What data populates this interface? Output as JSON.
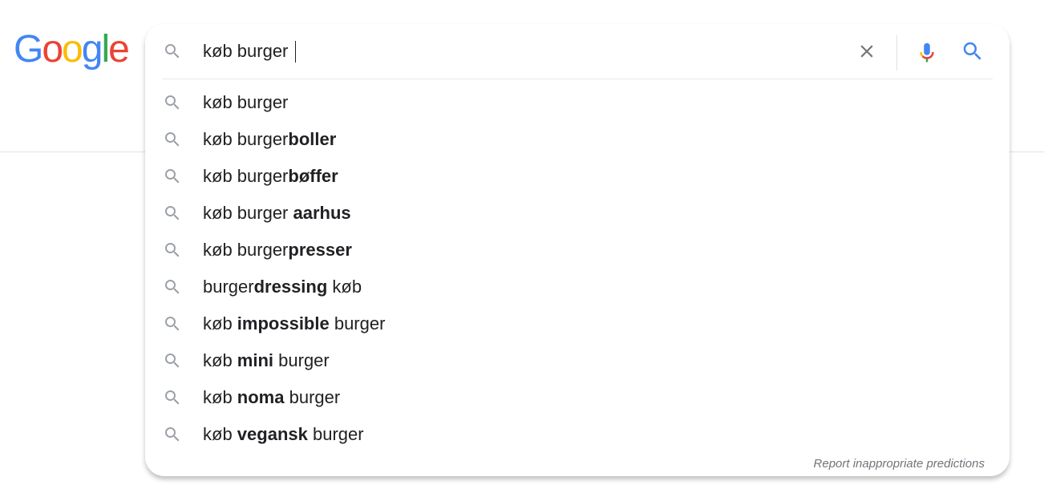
{
  "logo": {
    "letters": [
      "G",
      "o",
      "o",
      "g",
      "l",
      "e"
    ],
    "colors": {
      "blue": "#4285f4",
      "red": "#ea4335",
      "yellow": "#fbbc05",
      "green": "#34a853"
    }
  },
  "search": {
    "query": "køb burger",
    "icons": {
      "lead": "search-icon",
      "clear": "close-icon",
      "voice": "mic-icon",
      "submit": "search-icon"
    }
  },
  "suggestions": [
    {
      "pre": "køb burger",
      "bold": "",
      "post": ""
    },
    {
      "pre": "køb burger",
      "bold": "boller",
      "post": ""
    },
    {
      "pre": "køb burger",
      "bold": "bøffer",
      "post": ""
    },
    {
      "pre": "køb burger ",
      "bold": "aarhus",
      "post": ""
    },
    {
      "pre": "køb burger",
      "bold": "presser",
      "post": ""
    },
    {
      "pre": "burger",
      "bold": "dressing",
      "post": " køb"
    },
    {
      "pre": "køb ",
      "bold": "impossible",
      "post": " burger"
    },
    {
      "pre": "køb ",
      "bold": "mini",
      "post": " burger"
    },
    {
      "pre": "køb ",
      "bold": "noma",
      "post": " burger"
    },
    {
      "pre": "køb ",
      "bold": "vegansk",
      "post": " burger"
    }
  ],
  "footer": {
    "report_label": "Report inappropriate predictions"
  },
  "colors": {
    "text": "#202124",
    "icon_grey": "#9aa0a6",
    "link_grey": "#70757a",
    "clear_grey": "#70757a"
  }
}
